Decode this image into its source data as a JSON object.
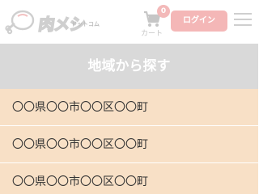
{
  "header": {
    "logo": {
      "main": "肉メシ",
      "sub": "ドットコム"
    },
    "cart": {
      "count": "0",
      "label": "カート"
    },
    "login_label": "ログイン"
  },
  "section": {
    "title": "地域から探す"
  },
  "areas": [
    {
      "label": "〇〇県〇〇市〇〇区〇〇町"
    },
    {
      "label": "〇〇県〇〇市〇〇区〇〇町"
    },
    {
      "label": "〇〇県〇〇市〇〇区〇〇町"
    }
  ]
}
